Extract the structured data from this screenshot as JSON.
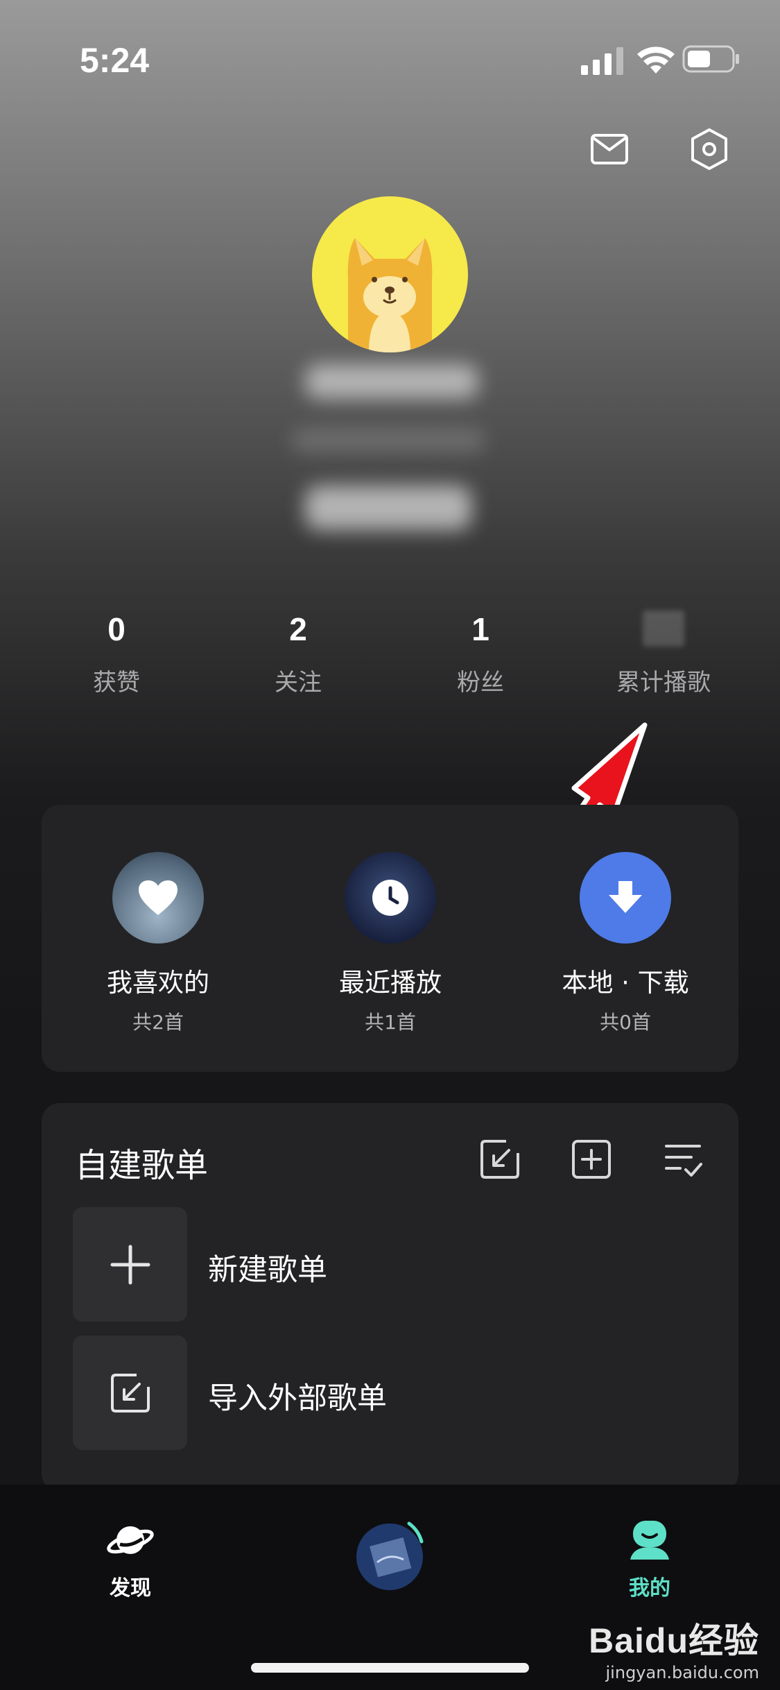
{
  "status_bar": {
    "time": "5:24"
  },
  "stats": [
    {
      "value": "0",
      "label": "获赞"
    },
    {
      "value": "2",
      "label": "关注"
    },
    {
      "value": "1",
      "label": "粉丝"
    },
    {
      "value": "",
      "label": "累计播歌"
    }
  ],
  "quick_access": [
    {
      "title": "我喜欢的",
      "subtitle": "共2首"
    },
    {
      "title": "最近播放",
      "subtitle": "共1首"
    },
    {
      "title": "本地 · 下载",
      "subtitle": "共0首"
    }
  ],
  "playlists": {
    "title": "自建歌单",
    "rows": [
      {
        "label": "新建歌单"
      },
      {
        "label": "导入外部歌单"
      }
    ]
  },
  "tabbar": {
    "discover": "发现",
    "mine": "我的",
    "active_color": "#5ee0c8"
  },
  "watermark": {
    "logo": "Baidu经验",
    "url": "jingyan.baidu.com"
  }
}
